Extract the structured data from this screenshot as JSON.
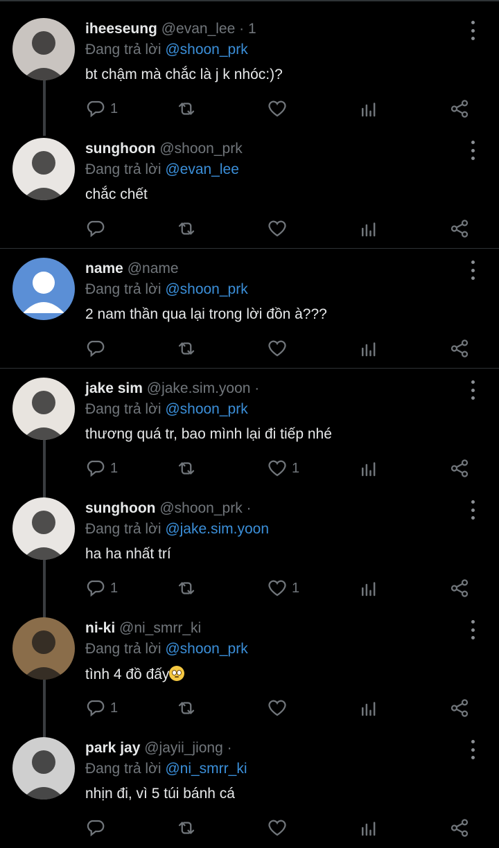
{
  "reply_prefix": "Đang trả lời",
  "tweets": [
    {
      "name": "iheeseung",
      "handle": "@evan_lee · 1",
      "reply_to": "@shoon_prk",
      "text": "bt chậm mà chắc là j k nhóc:)?",
      "reply_count": "1",
      "like_count": "",
      "avatar_color": "#c9c4c0"
    },
    {
      "name": "sunghoon",
      "handle": "@shoon_prk",
      "reply_to": "@evan_lee",
      "text": "chắc chết",
      "reply_count": "",
      "like_count": "",
      "avatar_color": "#e9e6e3"
    },
    {
      "name": "name",
      "handle": "@name",
      "reply_to": "@shoon_prk",
      "text": "2 nam thần qua lại trong lời đồn à???",
      "reply_count": "",
      "like_count": "",
      "avatar_color": "#5b8fd6"
    },
    {
      "name": "jake sim",
      "handle": "@jake.sim.yoon ·",
      "reply_to": "@shoon_prk",
      "text": "thương quá tr, bao mình lại đi tiếp nhé",
      "reply_count": "1",
      "like_count": "1",
      "avatar_color": "#e8e4df"
    },
    {
      "name": "sunghoon",
      "handle": "@shoon_prk ·",
      "reply_to": "@jake.sim.yoon",
      "text": "ha ha nhất trí",
      "reply_count": "1",
      "like_count": "1",
      "avatar_color": "#e9e6e3"
    },
    {
      "name": "ni-ki",
      "handle": "@ni_smrr_ki",
      "reply_to": "@shoon_prk",
      "text": "tình 4 đồ đấy",
      "reply_count": "1",
      "like_count": "",
      "avatar_color": "#8a6d4a"
    },
    {
      "name": "park jay",
      "handle": "@jayii_jiong ·",
      "reply_to": "@ni_smrr_ki",
      "text": "nhịn đi, vì 5 túi bánh cá",
      "reply_count": "",
      "like_count": "",
      "avatar_color": "#cfcfcf"
    }
  ],
  "icons": {
    "reply": "reply-icon",
    "retweet": "retweet-icon",
    "like": "heart-icon",
    "views": "analytics-icon",
    "share": "share-icon",
    "more": "more-icon"
  },
  "colors": {
    "mention": "#3b8fd9",
    "secondary_text": "#71767b",
    "background": "#000000"
  }
}
